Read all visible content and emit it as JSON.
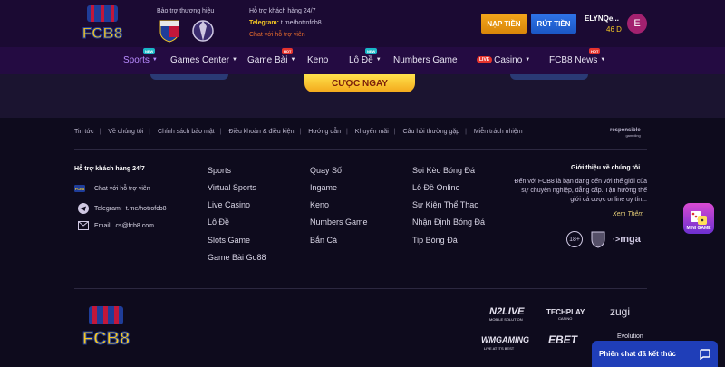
{
  "header": {
    "logo_text": "FCB8",
    "sponsor_title": "Bảo trợ thương hiệu",
    "support_title": "Hỗ trợ khách hàng 24/7",
    "telegram_label": "Telegram:",
    "telegram_value": "t.me/hotrofcb8",
    "chat_support": "Chat với hỗ trợ viên",
    "deposit_label": "NẠP TIỀN",
    "withdraw_label": "RÚT TIỀN",
    "username": "ELYNQe...",
    "balance": "46 D",
    "avatar_letter": "E"
  },
  "nav": {
    "items": [
      {
        "label": "Sports",
        "badge": "NEW"
      },
      {
        "label": "Games Center",
        "badge": ""
      },
      {
        "label": "Game Bài",
        "badge": "HOT"
      },
      {
        "label": "Keno",
        "badge": ""
      },
      {
        "label": "Lô Đề",
        "badge": "NEW"
      },
      {
        "label": "Numbers Game",
        "badge": ""
      },
      {
        "label": "Casino",
        "badge": "",
        "live": "LIVE"
      },
      {
        "label": "FCB8 News",
        "badge": "HOT"
      }
    ]
  },
  "banner": {
    "cta_label": "CƯỢC NGAY"
  },
  "footer": {
    "links": [
      "Tin tức",
      "Về chúng tôi",
      "Chính sách bảo mật",
      "Điều khoản & điều kiện",
      "Hướng dẫn",
      "Khuyến mãi",
      "Câu hỏi thường gặp",
      "Miễn trách nhiệm"
    ],
    "responsible_line1": "responsible",
    "responsible_line2": "gambling",
    "support": {
      "title": "Hỗ trợ khách hàng 24/7",
      "chat": "Chat với hỗ trợ viên",
      "telegram_label": "Telegram:",
      "telegram_value": "t.me/hotrofcb8",
      "email_label": "Email:",
      "email_value": "cs@fcb8.com"
    },
    "col2": [
      "Sports",
      "Virtual Sports",
      "Live Casino",
      "Lô Đề",
      "Slots Game",
      "Game Bài Go88"
    ],
    "col3": [
      "Quay Số",
      "Ingame",
      "Keno",
      "Numbers Game",
      "Bắn Cá"
    ],
    "col4": [
      "Soi Kèo Bóng Đá",
      "Lô Đề Online",
      "Sự Kiện Thể Thao",
      "Nhận Định Bóng Đá",
      "Tip Bóng Đá"
    ],
    "about": {
      "title": "Giới thiệu về chúng tôi",
      "text": "Đến với FCB8 là bạn đang đến với thế giới của sự chuyên nghiệp, đẳng cấp. Tận hưởng thế giới cá cược online uy tín...",
      "see_more": "Xem Thêm"
    },
    "cert_18": "18+",
    "cert_mga": "mga",
    "mini_game": "MINI GAME",
    "providers": [
      "N2LIVE",
      "MOBILE SOLUTION",
      "TECHPLAY",
      "CASINO",
      "zugi",
      "WMGAMING",
      "LIVE AT ITS BEST",
      "EBET",
      "Evolution"
    ]
  },
  "chat_widget": {
    "label": "Phiên chat đã kết thúc"
  }
}
